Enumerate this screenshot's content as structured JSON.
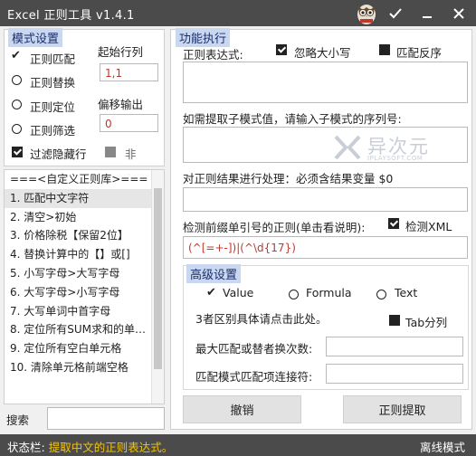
{
  "titlebar": {
    "title": "Excel 正则工具 v1.4.1",
    "buttons": [
      "check-icon",
      "minimize-icon",
      "close-icon"
    ]
  },
  "mode_section": {
    "title": "模式设置",
    "options": [
      "正则匹配",
      "正则替换",
      "正则定位",
      "正则筛选"
    ],
    "selected": "正则匹配",
    "filter_hidden_label": "过滤隐藏行",
    "filter_hidden_checked": true,
    "not_label": "非",
    "start_row_label": "起始行列",
    "start_row_value": "1,1",
    "offset_label": "偏移输出",
    "offset_value": "0"
  },
  "regex_library": {
    "header": "===<自定义正则库>===",
    "items": [
      "1. 匹配中文字符",
      "2. 清空>初始",
      "3. 价格除税【保留2位】",
      "4. 替换计算中的【】或[]",
      "5. 小写字母>大写字母",
      "6. 大写字母>小写字母",
      "7. 大写单词中首字母",
      "8. 定位所有SUM求和的单元格",
      "9. 定位所有空白单元格",
      "10. 清除单元格前端空格"
    ],
    "selected_index": 0
  },
  "search": {
    "label": "搜索",
    "value": ""
  },
  "function_section": {
    "title": "功能执行",
    "regex_label": "正则表达式:",
    "ignore_case_label": "忽略大小写",
    "ignore_case_checked": true,
    "match_reverse_label": "匹配反序",
    "match_reverse_checked": false,
    "submatch_label": "如需提取子模式值，请输入子模式的序列号:",
    "process_label": "对正则结果进行处理：必须含结果变量 $0",
    "quote_regex_label": "检测前缀单引号的正则(单击看说明):",
    "detect_xml_label": "检测XML",
    "detect_xml_checked": true,
    "quote_regex_value": "(^[=+-])|(^\\d{17})"
  },
  "advanced_section": {
    "title": "高级设置",
    "options": [
      "Value",
      "Formula",
      "Text"
    ],
    "selected": "Value",
    "difference_hint": "3者区别具体请点击此处。",
    "tab_split_label": "Tab分列",
    "tab_split_checked": false,
    "max_replace_label": "最大匹配或替者换次数:",
    "max_replace_value": "",
    "join_label": "匹配模式匹配项连接符:",
    "join_value": ""
  },
  "buttons": {
    "undo": "撤销",
    "extract": "正则提取"
  },
  "statusbar": {
    "label": "状态栏:",
    "message": "提取中文的正则表达式。",
    "mode": "离线模式"
  },
  "watermark": {
    "text": "异次元",
    "sub": "IPLAYSOFT.COM"
  }
}
